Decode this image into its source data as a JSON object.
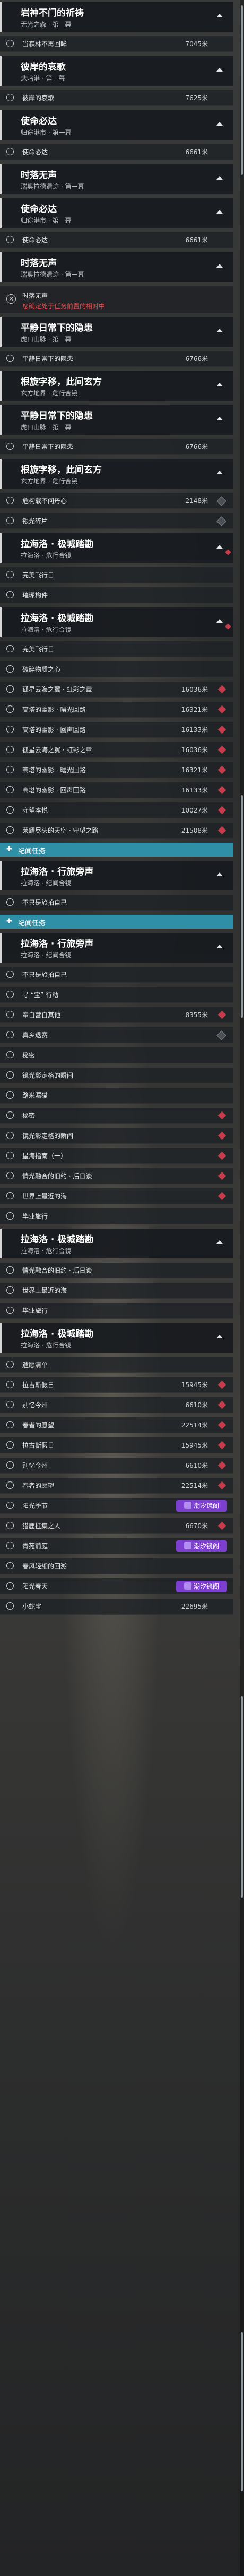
{
  "sections": {
    "world_quest": "纪闻任务"
  },
  "icons": {
    "check_circle": "circle-icon",
    "expand": "chevron-up-icon",
    "tracker_marker": "diamond-marker-icon",
    "cancel": "close-circle-icon",
    "badge": "purple-badge-icon"
  },
  "colors": {
    "accent_section": "#2e8fa7",
    "marker_red": "#c73b4a",
    "warning_text": "#e24a4a",
    "badge_purple": "#7d3fd0"
  },
  "rows": [
    {
      "type": "header",
      "title": "岩神不门的祈祷",
      "subtitle": "无光之森 · 第一幕",
      "mark": false
    },
    {
      "type": "task",
      "name": "当森林不再回眸",
      "dist": "7045米",
      "diamond": "none"
    },
    {
      "type": "header",
      "title": "彼岸的哀歌",
      "subtitle": "悲鸣港 · 第一幕",
      "mark": false
    },
    {
      "type": "task",
      "name": "彼岸的哀歌",
      "dist": "7625米",
      "diamond": "none"
    },
    {
      "type": "header",
      "title": "使命必达",
      "subtitle": "归途港市 · 第一幕",
      "mark": false
    },
    {
      "type": "task",
      "name": "使命必达",
      "dist": "6661米",
      "diamond": "none"
    },
    {
      "type": "header",
      "title": "时落无声",
      "subtitle": "瑞奥拉德遗迹 · 第一幕",
      "mark": false
    },
    {
      "type": "header",
      "title": "使命必达",
      "subtitle": "归途港市 · 第一幕",
      "mark": false
    },
    {
      "type": "task",
      "name": "使命必达",
      "dist": "6661米",
      "diamond": "none"
    },
    {
      "type": "header",
      "title": "时落无声",
      "subtitle": "瑞奥拉德遗迹 · 第一幕",
      "mark": false
    },
    {
      "type": "warning",
      "line1": "时落无声",
      "line2": "您确定处于任务前置的相对中"
    },
    {
      "type": "header",
      "title": "平静日常下的隐患",
      "subtitle": "虎口山脉 · 第一幕",
      "mark": false
    },
    {
      "type": "task",
      "name": "平静日常下的隐患",
      "dist": "6766米",
      "diamond": "none"
    },
    {
      "type": "header",
      "title": "根旋字移，此间玄方",
      "subtitle": "玄方地界 · 危行合镜",
      "mark": false
    },
    {
      "type": "header",
      "title": "平静日常下的隐患",
      "subtitle": "虎口山脉 · 第一幕",
      "mark": false
    },
    {
      "type": "task",
      "name": "平静日常下的隐患",
      "dist": "6766米",
      "diamond": "none"
    },
    {
      "type": "header",
      "title": "根旋字移，此间玄方",
      "subtitle": "玄方地界 · 危行合镜",
      "mark": false
    },
    {
      "type": "task",
      "name": "危构载不问丹心",
      "dist": "2148米",
      "diamond": "dim"
    },
    {
      "type": "task",
      "name": "银光碎片",
      "dist": "",
      "diamond": "dim"
    },
    {
      "type": "header",
      "title": "拉海洛 · 极城踏勘",
      "subtitle": "拉海洛 · 危行合镜",
      "mark": true
    },
    {
      "type": "task",
      "name": "完美飞行日",
      "dist": "",
      "diamond": "none"
    },
    {
      "type": "task",
      "name": "璀璨构件",
      "dist": "",
      "diamond": "none"
    },
    {
      "type": "header",
      "title": "拉海洛 · 极城踏勘",
      "subtitle": "拉海洛 · 危行合镜",
      "mark": true
    },
    {
      "type": "task",
      "name": "完美飞行日",
      "dist": "",
      "diamond": "none"
    },
    {
      "type": "task",
      "name": "破碎物质之心",
      "dist": "",
      "diamond": "none"
    },
    {
      "type": "task",
      "name": "孤星云海之翼 · 虹彩之章",
      "dist": "16036米",
      "diamond": "red"
    },
    {
      "type": "task",
      "name": "高塔的幽影 · 曙光回路",
      "dist": "16321米",
      "diamond": "red"
    },
    {
      "type": "task",
      "name": "高塔的幽影 · 回声回路",
      "dist": "16133米",
      "diamond": "red"
    },
    {
      "type": "task",
      "name": "孤星云海之翼 · 虹彩之章",
      "dist": "16036米",
      "diamond": "red"
    },
    {
      "type": "task",
      "name": "高塔的幽影 · 曙光回路",
      "dist": "16321米",
      "diamond": "red"
    },
    {
      "type": "task",
      "name": "高塔的幽影 · 回声回路",
      "dist": "16133米",
      "diamond": "red"
    },
    {
      "type": "task",
      "name": "守望本悦",
      "dist": "10027米",
      "diamond": "red"
    },
    {
      "type": "task",
      "name": "荣耀尽头的天空 · 守望之路",
      "dist": "21508米",
      "diamond": "red"
    },
    {
      "type": "section",
      "label": "纪闻任务"
    },
    {
      "type": "header",
      "title": "拉海洛 · 行旅旁声",
      "subtitle": "拉海洛 · 纪闻合镜",
      "mark": false
    },
    {
      "type": "task",
      "name": "不只是旅拍自己",
      "dist": "",
      "diamond": "none"
    },
    {
      "type": "section",
      "label": "纪闻任务"
    },
    {
      "type": "header",
      "title": "拉海洛 · 行旅旁声",
      "subtitle": "拉海洛 · 纪闻合镜",
      "mark": false
    },
    {
      "type": "task",
      "name": "不只是旅拍自己",
      "dist": "",
      "diamond": "none"
    },
    {
      "type": "task",
      "name": "寻 “宝” 行动",
      "dist": "",
      "diamond": "none"
    },
    {
      "type": "task",
      "name": "奉自营自其他",
      "dist": "8355米",
      "diamond": "red"
    },
    {
      "type": "task",
      "name": "真乡退赛",
      "dist": "",
      "diamond": "dim"
    },
    {
      "type": "task",
      "name": "秘密",
      "dist": "",
      "diamond": "none"
    },
    {
      "type": "task",
      "name": "镜光彰定格的瞬间",
      "dist": "",
      "diamond": "none"
    },
    {
      "type": "task",
      "name": "路米漏猫",
      "dist": "",
      "diamond": "none"
    },
    {
      "type": "task",
      "name": "秘密",
      "dist": "",
      "diamond": "red"
    },
    {
      "type": "task",
      "name": "镜光彰定格的瞬间",
      "dist": "",
      "diamond": "red"
    },
    {
      "type": "task",
      "name": "星海指南（一）",
      "dist": "",
      "diamond": "red"
    },
    {
      "type": "task",
      "name": "情光融合的旧约 · 后日谈",
      "dist": "",
      "diamond": "red"
    },
    {
      "type": "task",
      "name": "世界上最近的海",
      "dist": "",
      "diamond": "red"
    },
    {
      "type": "task",
      "name": "毕业旅行",
      "dist": "",
      "diamond": "none"
    },
    {
      "type": "header",
      "title": "拉海洛 · 极城踏勘",
      "subtitle": "拉海洛 · 危行合镜",
      "mark": false
    },
    {
      "type": "task",
      "name": "情光融合的旧约 · 后日谈",
      "dist": "",
      "diamond": "none"
    },
    {
      "type": "task",
      "name": "世界上最近的海",
      "dist": "",
      "diamond": "none"
    },
    {
      "type": "task",
      "name": "毕业旅行",
      "dist": "",
      "diamond": "none"
    },
    {
      "type": "header",
      "title": "拉海洛 · 极城踏勘",
      "subtitle": "拉海洛 · 危行合镜",
      "mark": false
    },
    {
      "type": "task",
      "name": "遗愿清单",
      "dist": "",
      "diamond": "none"
    },
    {
      "type": "task",
      "name": "拉古斯假日",
      "dist": "15945米",
      "diamond": "red"
    },
    {
      "type": "task",
      "name": "别忆今州",
      "dist": "6610米",
      "diamond": "red"
    },
    {
      "type": "task",
      "name": "春者的愿望",
      "dist": "22514米",
      "diamond": "red"
    },
    {
      "type": "task",
      "name": "拉古斯假日",
      "dist": "15945米",
      "diamond": "red"
    },
    {
      "type": "task",
      "name": "别忆今州",
      "dist": "6610米",
      "diamond": "red"
    },
    {
      "type": "task",
      "name": "春者的愿望",
      "dist": "22514米",
      "diamond": "red"
    },
    {
      "type": "task",
      "name": "阳光季节",
      "dist": "",
      "diamond": "badge",
      "badge": "潮汐镜阁"
    },
    {
      "type": "task",
      "name": "猎鹿挂集之人",
      "dist": "6670米",
      "diamond": "red"
    },
    {
      "type": "task",
      "name": "青苑前庭",
      "dist": "",
      "diamond": "badge",
      "badge": "潮汐镜阁"
    },
    {
      "type": "task",
      "name": "春风轻细的回溯",
      "dist": "",
      "diamond": "none"
    },
    {
      "type": "task",
      "name": "阳光春天",
      "dist": "",
      "diamond": "badge",
      "badge": "潮汐镜阁"
    },
    {
      "type": "task",
      "name": "小蛇宝",
      "dist": "22695米",
      "diamond": "none"
    }
  ]
}
